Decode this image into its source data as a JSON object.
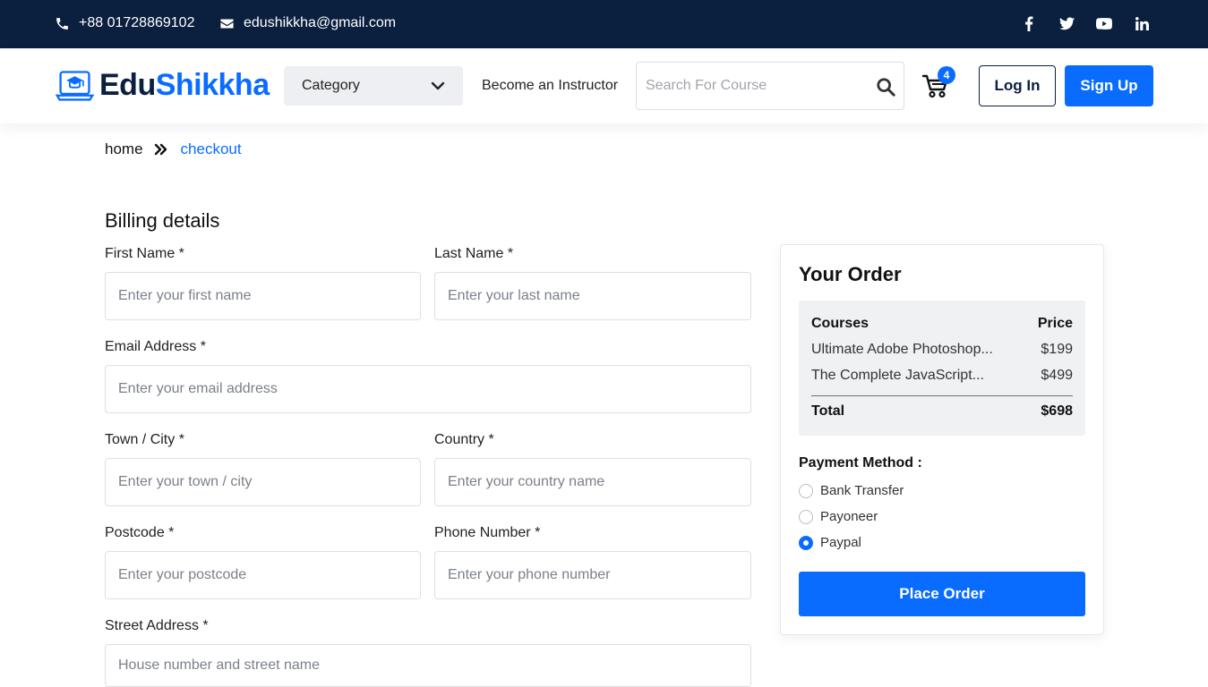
{
  "topbar": {
    "phone": "+88 01728869102",
    "email": "edushikkha@gmail.com",
    "social": [
      "facebook-icon",
      "twitter-icon",
      "youtube-icon",
      "linkedin-icon"
    ]
  },
  "header": {
    "logo_part1": "Edu",
    "logo_part2": "Shikkha",
    "category_label": "Category",
    "instructor_link": "Become an Instructor",
    "search_placeholder": "Search For Course",
    "cart_count": "4",
    "login_label": "Log In",
    "signup_label": "Sign Up"
  },
  "breadcrumb": {
    "home": "home",
    "current": "checkout"
  },
  "billing": {
    "title": "Billing details",
    "first_name": {
      "label": "First Name *",
      "placeholder": "Enter your first name"
    },
    "last_name": {
      "label": "Last Name *",
      "placeholder": "Enter your last name"
    },
    "email": {
      "label": "Email Address *",
      "placeholder": "Enter your email address"
    },
    "city": {
      "label": "Town / City *",
      "placeholder": "Enter your town / city"
    },
    "country": {
      "label": "Country *",
      "placeholder": "Enter your country name"
    },
    "postcode": {
      "label": "Postcode *",
      "placeholder": "Enter your postcode"
    },
    "phone": {
      "label": "Phone Number *",
      "placeholder": "Enter your phone number"
    },
    "street": {
      "label": "Street Address *",
      "placeholder": "House number and street name"
    }
  },
  "order": {
    "title": "Your Order",
    "col_courses": "Courses",
    "col_price": "Price",
    "items": [
      {
        "name": "Ultimate Adobe Photoshop...",
        "price": "$199"
      },
      {
        "name": "The Complete JavaScript...",
        "price": "$499"
      }
    ],
    "total_label": "Total",
    "total_value": "$698",
    "payment_label": "Payment Method :",
    "payment_options": [
      {
        "label": "Bank Transfer",
        "selected": false
      },
      {
        "label": "Payoneer",
        "selected": false
      },
      {
        "label": "Paypal",
        "selected": true
      }
    ],
    "place_order_label": "Place Order"
  },
  "colors": {
    "topbar_bg": "#0b1f3f",
    "accent": "#0a6cff"
  }
}
